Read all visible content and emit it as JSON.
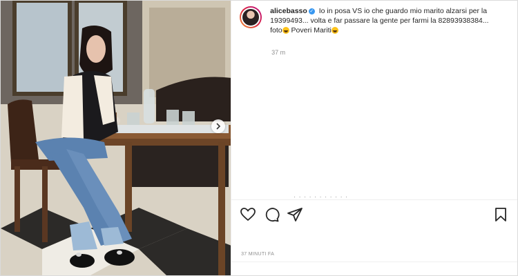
{
  "post": {
    "username": "alicebasso",
    "verified_badge": "✓",
    "caption_lines": [
      "Io in posa VS io che guardo mio marito alzarsi per la",
      "19399493... volta e far passare la gente per farmi la 82893938384...",
      "foto",
      "Poveri Mariti"
    ],
    "time_short": "37 m",
    "time_long": "37 MINUTI FA",
    "truncated_comment": "· · · · · · · · · · ·"
  },
  "icons": {
    "like": "heart-icon",
    "comment": "comment-icon",
    "share": "paper-plane-icon",
    "save": "bookmark-icon",
    "next": "chevron-right-icon"
  },
  "colors": {
    "verified": "#3897f0",
    "text": "#262626",
    "muted": "#8e8e8e"
  }
}
